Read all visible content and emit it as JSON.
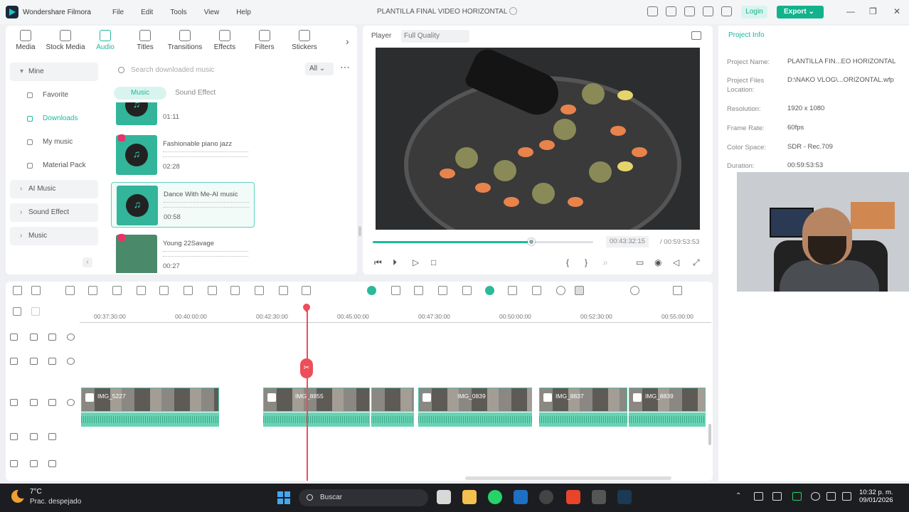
{
  "app": {
    "name": "Wondershare Filmora",
    "menus": [
      "File",
      "Edit",
      "Tools",
      "View",
      "Help"
    ],
    "project_title": "PLANTILLA FINAL VIDEO HORIZONTAL",
    "login": "Login",
    "export": "Export"
  },
  "library": {
    "tabs": [
      {
        "label": "Media",
        "icon": "media-icon"
      },
      {
        "label": "Stock Media",
        "icon": "stock-media-icon"
      },
      {
        "label": "Audio",
        "icon": "music-note-icon"
      },
      {
        "label": "Titles",
        "icon": "titles-icon"
      },
      {
        "label": "Transitions",
        "icon": "transitions-icon"
      },
      {
        "label": "Effects",
        "icon": "effects-icon"
      },
      {
        "label": "Filters",
        "icon": "filters-icon"
      },
      {
        "label": "Stickers",
        "icon": "stickers-icon"
      }
    ],
    "sidebar": {
      "mine": "Mine",
      "favorite": "Favorite",
      "downloads": "Downloads",
      "my_music": "My music",
      "material_pack": "Material Pack",
      "ai_music": "AI Music",
      "sound_effect": "Sound Effect",
      "music": "Music"
    },
    "search_placeholder": "Search downloaded music",
    "filter": "All",
    "subtabs": [
      "Music",
      "Sound Effect"
    ],
    "clips": [
      {
        "title": "",
        "duration": "01:11"
      },
      {
        "title": "Fashionable piano jazz",
        "duration": "02:28"
      },
      {
        "title": "Dance With Me-AI music",
        "duration": "00:58"
      },
      {
        "title": "Young 22Savage",
        "duration": "00:27"
      }
    ]
  },
  "player": {
    "label": "Player",
    "quality": "Full Quality",
    "current_time": "00:43:32:15",
    "separator": "/",
    "total_time": "00:59:53:53",
    "progress": 0.72
  },
  "project_info": {
    "tab": "Project Info",
    "rows": [
      {
        "label": "Project Name:",
        "value": "PLANTILLA FIN...EO HORIZONTAL"
      },
      {
        "label": "Project Files Location:",
        "value": "D:\\NAKO VLOG\\...ORIZONTAL.wfp"
      },
      {
        "label": "Resolution:",
        "value": "1920 x 1080"
      },
      {
        "label": "Frame Rate:",
        "value": "60fps"
      },
      {
        "label": "Color Space:",
        "value": "SDR - Rec.709"
      },
      {
        "label": "Duration:",
        "value": "00:59:53:53"
      }
    ]
  },
  "timeline": {
    "ruler": [
      "00:37:30:00",
      "00:40:00:00",
      "00:42:30:00",
      "00:45:00:00",
      "00:47:30:00",
      "00:50:00:00",
      "00:52:30:00",
      "00:55:00:00"
    ],
    "clips": [
      "IMG_5227",
      "IMG_8855",
      "IMG_0839",
      "IMG_8837",
      "IMG_8839"
    ]
  },
  "taskbar": {
    "temp": "7°C",
    "weather": "Prac. despejado",
    "search": "Buscar",
    "time": "10:32 p. m.",
    "date": "09/01/2026"
  }
}
